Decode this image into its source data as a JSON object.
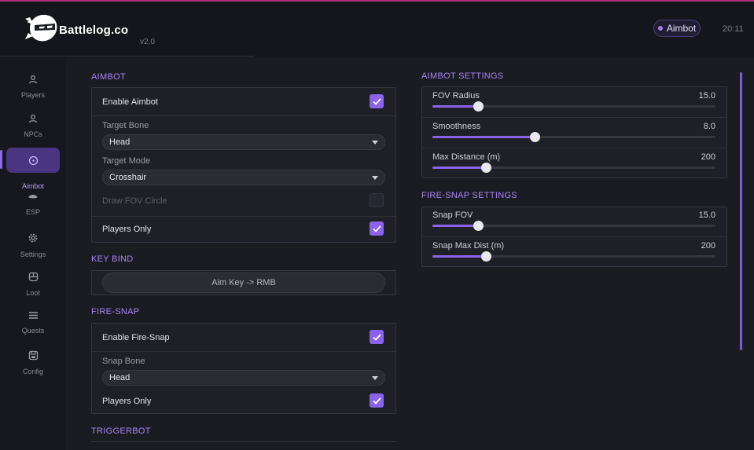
{
  "app": {
    "brand": "Battlelog.co",
    "version": "v2.0",
    "badge": "Aimbot",
    "clock": "20:11",
    "accent": "#8a63ea"
  },
  "sidebar": {
    "items": [
      {
        "label": "Players",
        "icon": "user-icon",
        "active": false
      },
      {
        "label": "NPCs",
        "icon": "user-icon",
        "active": false
      },
      {
        "label": "Aimbot",
        "icon": "crosshair-icon",
        "active": true
      },
      {
        "label": "ESP",
        "icon": "eye-icon",
        "active": false
      },
      {
        "label": "Settings",
        "icon": "gear-icon",
        "active": false
      },
      {
        "label": "Loot",
        "icon": "box-icon",
        "active": false
      },
      {
        "label": "Quests",
        "icon": "list-icon",
        "active": false
      },
      {
        "label": "Config",
        "icon": "save-icon",
        "active": false
      }
    ]
  },
  "aimbot": {
    "title": "AIMBOT",
    "enable_label": "Enable Aimbot",
    "enable_checked": true,
    "target_bone_label": "Target Bone",
    "target_bone_value": "Head",
    "target_mode_label": "Target Mode",
    "target_mode_value": "Crosshair",
    "fov_circle_label": "Draw FOV Circle",
    "fov_circle_checked": false,
    "players_only_label": "Players Only",
    "players_only_checked": true
  },
  "keybind": {
    "title": "KEY BIND",
    "label": "Aim Key  ->  RMB"
  },
  "firesnap": {
    "title": "FIRE-SNAP",
    "enable_label": "Enable Fire-Snap",
    "enable_checked": true,
    "snap_bone_label": "Snap Bone",
    "snap_bone_value": "Head",
    "players_only_label": "Players Only",
    "players_only_checked": true
  },
  "triggerbot": {
    "title": "TRIGGERBOT"
  },
  "aimbot_settings": {
    "title": "AIMBOT SETTINGS",
    "sliders": [
      {
        "label": "FOV Radius",
        "value": "15.0",
        "fraction": 0.16
      },
      {
        "label": "Smoothness",
        "value": "8.0",
        "fraction": 0.36
      },
      {
        "label": "Max Distance (m)",
        "value": "200",
        "fraction": 0.19
      }
    ]
  },
  "firesnap_settings": {
    "title": "FIRE-SNAP SETTINGS",
    "sliders": [
      {
        "label": "Snap FOV",
        "value": "15.0",
        "fraction": 0.16
      },
      {
        "label": "Snap Max Dist (m)",
        "value": "200",
        "fraction": 0.19
      }
    ]
  }
}
